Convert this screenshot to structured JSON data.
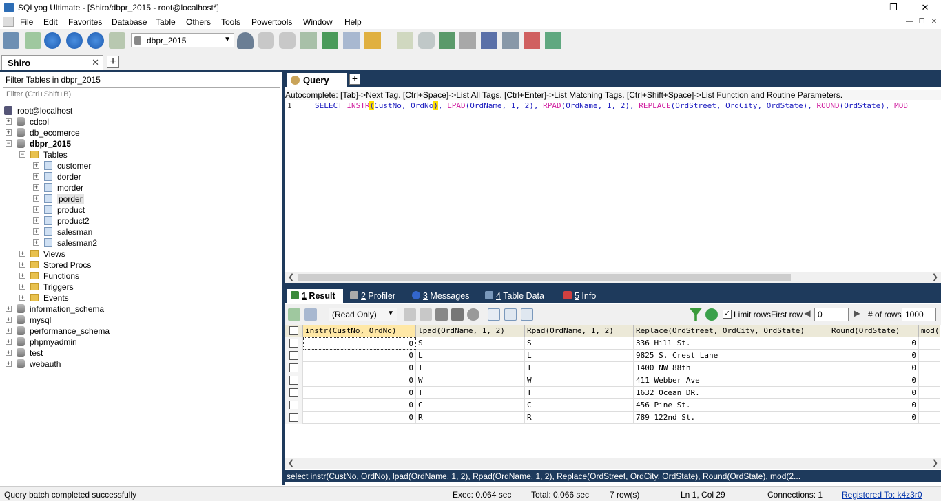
{
  "window": {
    "title": "SQLyog Ultimate - [Shiro/dbpr_2015 - root@localhost*]",
    "minimize": "—",
    "restore": "❐",
    "close": "✕"
  },
  "menu": [
    "File",
    "Edit",
    "Favorites",
    "Database",
    "Table",
    "Others",
    "Tools",
    "Powertools",
    "Window",
    "Help"
  ],
  "toolbar": {
    "database": "dbpr_2015"
  },
  "connection_tab": {
    "label": "Shiro",
    "close": "✕"
  },
  "left": {
    "filter_label": "Filter Tables in dbpr_2015",
    "filter_placeholder": "Filter (Ctrl+Shift+B)",
    "tree": [
      {
        "label": "root@localhost",
        "level": 0,
        "icon": "server",
        "exp": ""
      },
      {
        "label": "cdcol",
        "level": 1,
        "icon": "db",
        "exp": "+"
      },
      {
        "label": "db_ecomerce",
        "level": 1,
        "icon": "db",
        "exp": "+"
      },
      {
        "label": "dbpr_2015",
        "level": 1,
        "icon": "db",
        "exp": "−",
        "bold": true
      },
      {
        "label": "Tables",
        "level": 2,
        "icon": "folder",
        "exp": "−"
      },
      {
        "label": "customer",
        "level": 3,
        "icon": "table",
        "exp": "+"
      },
      {
        "label": "dorder",
        "level": 3,
        "icon": "table",
        "exp": "+"
      },
      {
        "label": "morder",
        "level": 3,
        "icon": "table",
        "exp": "+"
      },
      {
        "label": "porder",
        "level": 3,
        "icon": "table",
        "exp": "+",
        "selected": true
      },
      {
        "label": "product",
        "level": 3,
        "icon": "table",
        "exp": "+"
      },
      {
        "label": "product2",
        "level": 3,
        "icon": "table",
        "exp": "+"
      },
      {
        "label": "salesman",
        "level": 3,
        "icon": "table",
        "exp": "+"
      },
      {
        "label": "salesman2",
        "level": 3,
        "icon": "table",
        "exp": "+"
      },
      {
        "label": "Views",
        "level": 2,
        "icon": "folder",
        "exp": "+"
      },
      {
        "label": "Stored Procs",
        "level": 2,
        "icon": "folder",
        "exp": "+"
      },
      {
        "label": "Functions",
        "level": 2,
        "icon": "folder",
        "exp": "+"
      },
      {
        "label": "Triggers",
        "level": 2,
        "icon": "folder",
        "exp": "+"
      },
      {
        "label": "Events",
        "level": 2,
        "icon": "folder",
        "exp": "+"
      },
      {
        "label": "information_schema",
        "level": 1,
        "icon": "db",
        "exp": "+"
      },
      {
        "label": "mysql",
        "level": 1,
        "icon": "db",
        "exp": "+"
      },
      {
        "label": "performance_schema",
        "level": 1,
        "icon": "db",
        "exp": "+"
      },
      {
        "label": "phpmyadmin",
        "level": 1,
        "icon": "db",
        "exp": "+"
      },
      {
        "label": "test",
        "level": 1,
        "icon": "db",
        "exp": "+"
      },
      {
        "label": "webauth",
        "level": 1,
        "icon": "db",
        "exp": "+"
      }
    ]
  },
  "query": {
    "tab_label": "Query",
    "autocomplete": "Autocomplete: [Tab]->Next Tag. [Ctrl+Space]->List All Tags. [Ctrl+Enter]->List Matching Tags. [Ctrl+Shift+Space]->List Function and Routine Parameters.",
    "line_number": "1",
    "sql_parts": [
      {
        "t": "SELECT  ",
        "c": "kw"
      },
      {
        "t": "INSTR",
        "c": "fn"
      },
      {
        "t": "(",
        "c": "hl"
      },
      {
        "t": "CustNo, OrdNo",
        "c": "kw"
      },
      {
        "t": ")",
        "c": "hl"
      },
      {
        "t": ", ",
        "c": "kw"
      },
      {
        "t": "LPAD",
        "c": "fn"
      },
      {
        "t": "(OrdName, 1, 2), ",
        "c": "kw"
      },
      {
        "t": "RPAD",
        "c": "fn"
      },
      {
        "t": "(OrdName, 1, 2), ",
        "c": "kw"
      },
      {
        "t": "REPLACE",
        "c": "fn"
      },
      {
        "t": "(OrdStreet, OrdCity, OrdState), ",
        "c": "kw"
      },
      {
        "t": "ROUND",
        "c": "fn"
      },
      {
        "t": "(OrdState), ",
        "c": "kw"
      },
      {
        "t": "MOD",
        "c": "fn"
      }
    ]
  },
  "result_tabs": [
    {
      "num": "1",
      "label": " Result",
      "active": true,
      "color": "#3a8a3a"
    },
    {
      "num": "2",
      "label": " Profiler",
      "active": false,
      "color": "#aaaaaa"
    },
    {
      "num": "3",
      "label": " Messages",
      "active": false,
      "color": "#3366cc"
    },
    {
      "num": "4",
      "label": " Table Data",
      "active": false,
      "color": "#7a98bb"
    },
    {
      "num": "5",
      "label": " Info",
      "active": false,
      "color": "#d04040"
    }
  ],
  "result_toolbar": {
    "mode": "(Read Only)",
    "limit_rows": "Limit rows",
    "first_row_label": "First row",
    "first_row": "0",
    "num_rows_label": "# of rows",
    "num_rows": "1000"
  },
  "grid": {
    "columns": [
      "instr(CustNo, OrdNo)",
      "lpad(OrdName, 1, 2)",
      "Rpad(OrdName, 1, 2)",
      "Replace(OrdStreet, OrdCity, OrdState)",
      "Round(OrdState)",
      "mod("
    ],
    "rows": [
      [
        "0",
        "S",
        "S",
        "336 Hill St.",
        "0"
      ],
      [
        "0",
        "L",
        "L",
        "9825 S. Crest Lane",
        "0"
      ],
      [
        "0",
        "T",
        "T",
        "1400 NW 88th",
        "0"
      ],
      [
        "0",
        "W",
        "W",
        "411 Webber Ave",
        "0"
      ],
      [
        "0",
        "T",
        "T",
        "1632 Ocean DR.",
        "0"
      ],
      [
        "0",
        "C",
        "C",
        "456 Pine St.",
        "0"
      ],
      [
        "0",
        "R",
        "R",
        "789 122nd St.",
        "0"
      ]
    ]
  },
  "sql_echo": "select instr(CustNo, OrdNo), lpad(OrdName, 1, 2), Rpad(OrdName, 1, 2), Replace(OrdStreet, OrdCity, OrdState), Round(OrdState), mod(2...",
  "status": {
    "message": "Query batch completed successfully",
    "exec": "Exec: 0.064 sec",
    "total": "Total: 0.066 sec",
    "rows": "7 row(s)",
    "position": "Ln 1, Col 29",
    "connections": "Connections: 1",
    "registered": "Registered To: k4z3r0"
  }
}
